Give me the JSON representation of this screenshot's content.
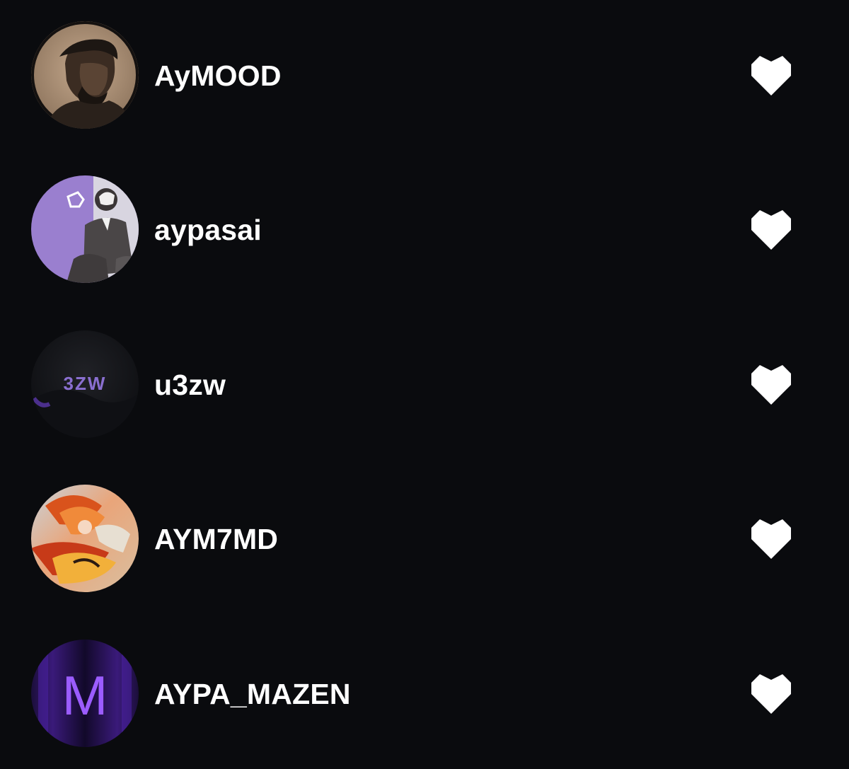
{
  "likes_list": {
    "items": [
      {
        "username": "AyMOOD",
        "avatar": "avatar-photo-man",
        "like_icon": "heart-icon"
      },
      {
        "username": "aypasai",
        "avatar": "avatar-purple-illustration",
        "like_icon": "heart-icon"
      },
      {
        "username": "u3zw",
        "avatar": "avatar-logo-dark",
        "avatar_text": "3ZW",
        "like_icon": "heart-icon"
      },
      {
        "username": "AYM7MD",
        "avatar": "avatar-fiery-artwork",
        "like_icon": "heart-icon"
      },
      {
        "username": "AYPA_MAZEN",
        "avatar": "avatar-letter-m",
        "avatar_text": "M",
        "like_icon": "heart-icon"
      }
    ]
  },
  "colors": {
    "background": "#0a0b0e",
    "text": "#ffffff",
    "heart": "#ffffff",
    "accent_purple": "#8a4dff"
  }
}
